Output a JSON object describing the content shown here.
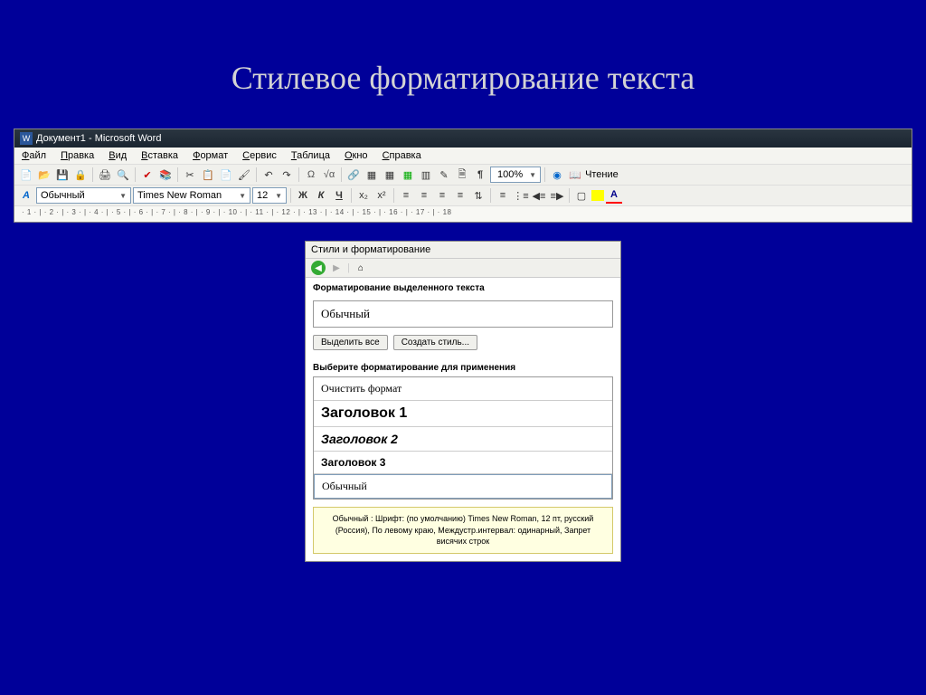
{
  "slide": {
    "title": "Стилевое форматирование текста"
  },
  "word": {
    "titlebar": {
      "icon_letter": "W",
      "text": "Документ1 - Microsoft Word"
    },
    "menu": [
      "Файл",
      "Правка",
      "Вид",
      "Вставка",
      "Формат",
      "Сервис",
      "Таблица",
      "Окно",
      "Справка"
    ],
    "format_row": {
      "style_icon": "A",
      "style": "Обычный",
      "font": "Times New Roman",
      "size": "12",
      "bold": "Ж",
      "italic": "К",
      "underline": "Ч",
      "super": "x₂",
      "sub": "x²",
      "font_color_letter": "A"
    },
    "zoom": "100%",
    "reading": "Чтение",
    "ruler": "· 1 · | · 2 · | · 3 · | · 4 · | · 5 · | · 6 · | · 7 · | · 8 · | · 9 · | · 10 · | · 11 · | · 12 · | · 13 · | · 14 · | · 15 · | · 16 · | · 17 · | · 18"
  },
  "styles_panel": {
    "title": "Стили и форматирование",
    "section1": "Форматирование выделенного текста",
    "current": "Обычный",
    "btn_select_all": "Выделить все",
    "btn_new_style": "Создать стиль...",
    "section2": "Выберите форматирование для применения",
    "items": {
      "clear": "Очистить формат",
      "h1": "Заголовок 1",
      "h2": "Заголовок 2",
      "h3": "Заголовок 3",
      "normal": "Обычный"
    },
    "description": "Обычный : Шрифт: (по умолчанию) Times New Roman, 12 пт, русский (Россия), По левому краю, Междустр.интервал:  одинарный, Запрет висячих строк"
  }
}
